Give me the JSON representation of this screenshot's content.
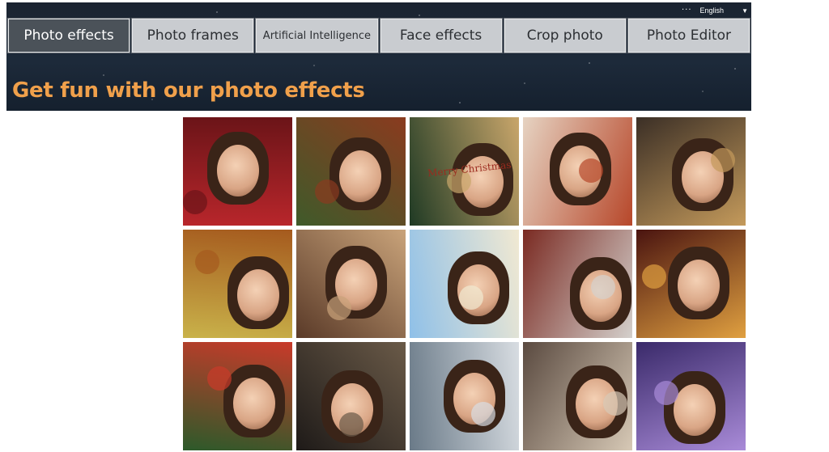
{
  "language": {
    "selected": "English",
    "menu_dots": "···"
  },
  "nav": {
    "tabs": [
      {
        "label": "Photo effects",
        "active": true
      },
      {
        "label": "Photo frames",
        "active": false
      },
      {
        "label": "Artificial Intelligence",
        "active": false
      },
      {
        "label": "Face effects",
        "active": false
      },
      {
        "label": "Crop photo",
        "active": false
      },
      {
        "label": "Photo Editor",
        "active": false
      }
    ]
  },
  "hero": {
    "title": "Get fun with our photo effects"
  },
  "gallery": {
    "tiles": [
      {
        "name": "heart-frame-roses-tile",
        "bg": "#b8262b",
        "bg2": "#6b1418"
      },
      {
        "name": "christmas-pine-frame-tile",
        "bg": "#3f5a2a",
        "bg2": "#8a3b1f"
      },
      {
        "name": "merry-christmas-sign-tile",
        "bg": "#1f3a24",
        "bg2": "#c9a66b",
        "sign_text": "Merry Christmas"
      },
      {
        "name": "autumn-winter-girl-tile",
        "bg": "#e6d3c2",
        "bg2": "#b7472a"
      },
      {
        "name": "halloween-moon-girl-tile",
        "bg": "#3b2f26",
        "bg2": "#c49a5b"
      },
      {
        "name": "autumn-couple-pumpkins-tile",
        "bg": "#c9b24a",
        "bg2": "#a55a1e"
      },
      {
        "name": "living-room-frame-tile",
        "bg": "#5a3a28",
        "bg2": "#c9a37a"
      },
      {
        "name": "beach-sky-face-tile",
        "bg": "#8fc0e8",
        "bg2": "#f1e9d2"
      },
      {
        "name": "book-rose-couple-tile",
        "bg": "#7a2a22",
        "bg2": "#d4d0cc"
      },
      {
        "name": "santa-hat-bokeh-tile",
        "bg": "#4a1410",
        "bg2": "#e0a040"
      },
      {
        "name": "christmas-ornaments-tile",
        "bg": "#2c5a2a",
        "bg2": "#c93a2a"
      },
      {
        "name": "phone-in-hands-tile",
        "bg": "#1e1a18",
        "bg2": "#6a5a48"
      },
      {
        "name": "snowy-forest-man-tile",
        "bg": "#6a7a88",
        "bg2": "#d8dde2"
      },
      {
        "name": "vintage-frame-portrait-tile",
        "bg": "#5a4a40",
        "bg2": "#d7c9b6"
      },
      {
        "name": "purple-night-forest-tile",
        "bg": "#3a2a6a",
        "bg2": "#a98bd8"
      }
    ]
  }
}
